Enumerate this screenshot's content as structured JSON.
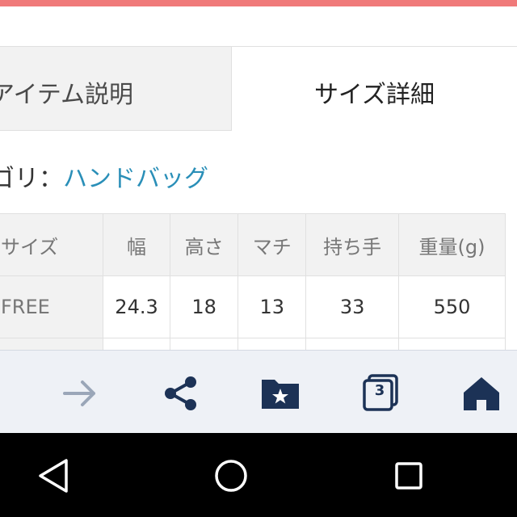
{
  "colors": {
    "accent_bar": "#f07a7a",
    "link": "#2a8fb8",
    "icon_active": "#1c3256",
    "icon_disabled": "#9aa6b8",
    "bottom_bar_bg": "#eef1f6",
    "nav_bg": "#000000"
  },
  "tabs": {
    "item_description": "アイテム説明",
    "size_details": "サイズ詳細"
  },
  "category": {
    "label": "ゴリ：",
    "value": "ハンドバッグ"
  },
  "size_table": {
    "headers": [
      "サイズ",
      "幅",
      "高さ",
      "マチ",
      "持ち手",
      "重量(g)"
    ],
    "rows": [
      [
        "FREE",
        "24.3",
        "18",
        "13",
        "33",
        "550"
      ]
    ]
  },
  "browser_bar": {
    "forward_icon": "arrow-right-icon",
    "share_icon": "share-icon",
    "bookmark_icon": "folder-star-icon",
    "tabs_icon": "tabs-icon",
    "tab_count": "3",
    "home_icon": "home-icon"
  },
  "android_nav": {
    "back_icon": "triangle-back-icon",
    "home_icon": "circle-home-icon",
    "recents_icon": "square-recents-icon"
  }
}
